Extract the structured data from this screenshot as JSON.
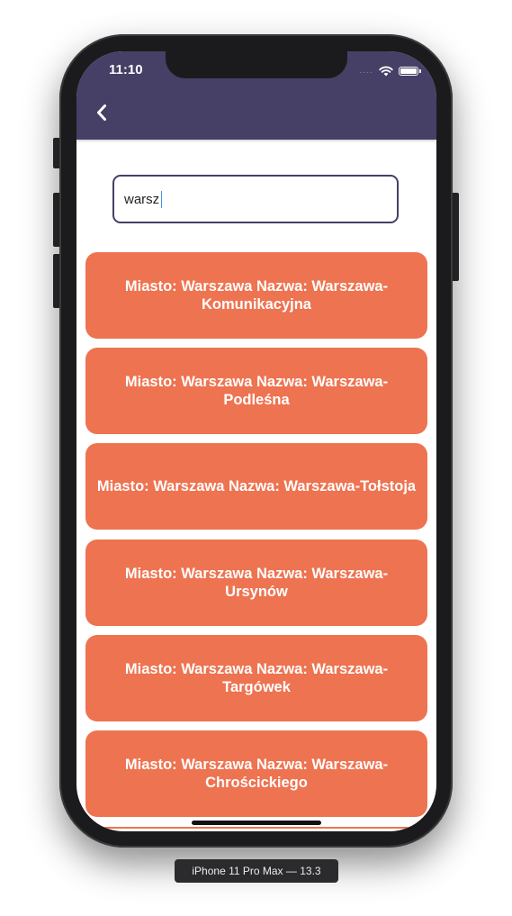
{
  "status_bar": {
    "time": "11:10",
    "signal": "....",
    "icons": [
      "wifi-icon",
      "battery-icon"
    ]
  },
  "header": {
    "back_icon": "chevron-left-icon",
    "background_color": "#463f66"
  },
  "search": {
    "value": "warsz",
    "border_color": "#463f66"
  },
  "results": {
    "card_color": "#ee7350",
    "items": [
      {
        "label": "Miasto: Warszawa Nazwa: Warszawa-Komunikacyjna"
      },
      {
        "label": "Miasto: Warszawa Nazwa: Warszawa-Podleśna"
      },
      {
        "label": "Miasto: Warszawa Nazwa: Warszawa-Tołstoja"
      },
      {
        "label": "Miasto: Warszawa Nazwa: Warszawa-Ursynów"
      },
      {
        "label": "Miasto: Warszawa Nazwa: Warszawa-Targówek"
      },
      {
        "label": "Miasto: Warszawa Nazwa: Warszawa-Chrościckiego"
      }
    ]
  },
  "device": {
    "label": "iPhone 11 Pro Max — 13.3"
  }
}
